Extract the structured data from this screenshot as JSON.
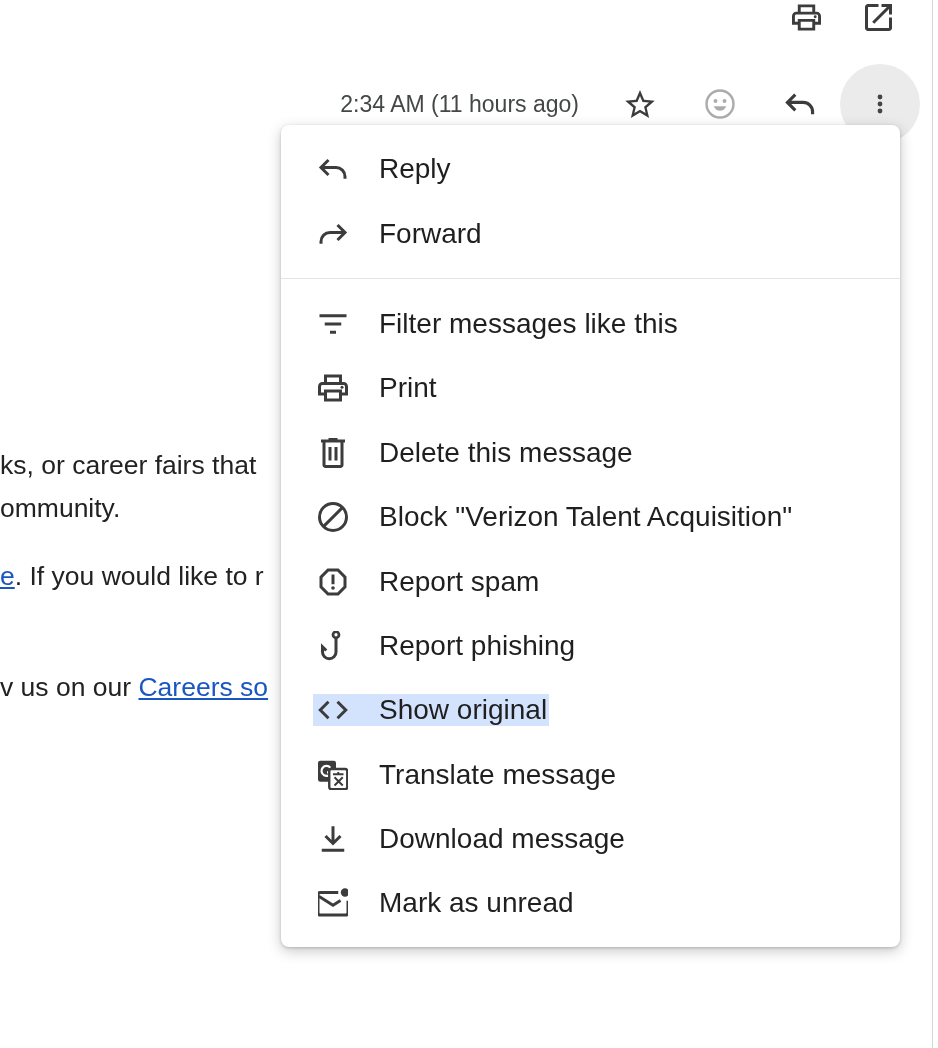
{
  "header": {
    "time": "2:34 AM (11 hours ago)"
  },
  "email_body": [
    {
      "lines": [
        [
          {
            "kind": "text",
            "text": "ks, or career fairs that"
          }
        ],
        [
          {
            "kind": "text",
            "text": "ommunity."
          }
        ]
      ]
    },
    {
      "lines": [
        [
          {
            "kind": "link",
            "text": "e"
          },
          {
            "kind": "text",
            "text": ". If you would like to r"
          }
        ]
      ]
    },
    {
      "lines": [
        [
          {
            "kind": "text",
            "text": "v us on our "
          },
          {
            "kind": "link",
            "text": "Careers so"
          }
        ]
      ]
    }
  ],
  "menu": {
    "groups": [
      {
        "items": [
          {
            "label": "Reply",
            "selected": false
          },
          {
            "label": "Forward",
            "selected": false
          }
        ]
      },
      {
        "items": [
          {
            "label": "Filter messages like this",
            "selected": false
          },
          {
            "label": "Print",
            "selected": false
          },
          {
            "label": "Delete this message",
            "selected": false
          },
          {
            "label": "Block \"Verizon Talent Acquisition\"",
            "selected": false
          },
          {
            "label": "Report spam",
            "selected": false
          },
          {
            "label": "Report phishing",
            "selected": false
          },
          {
            "label": "Show original",
            "selected": true
          },
          {
            "label": "Translate message",
            "selected": false
          },
          {
            "label": "Download message",
            "selected": false
          },
          {
            "label": "Mark as unread",
            "selected": false
          }
        ]
      }
    ]
  }
}
